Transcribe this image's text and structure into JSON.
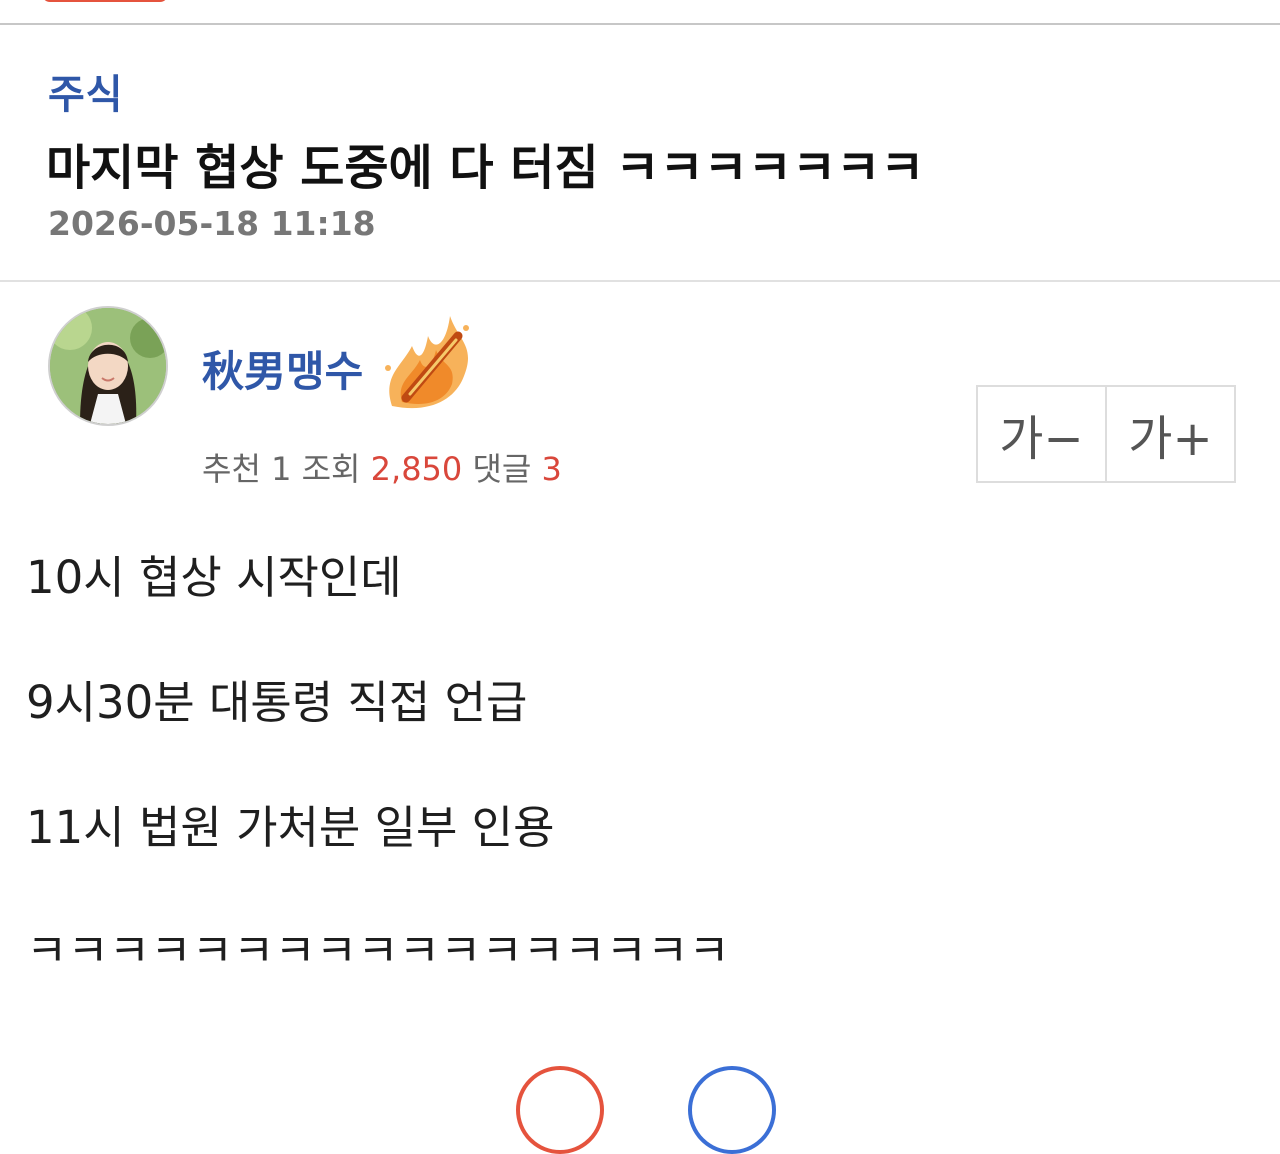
{
  "post": {
    "category": "주식",
    "title": "마지막 협상 도중에 다 터짐 ㅋㅋㅋㅋㅋㅋㅋ",
    "datetime": "2026-05-18 11:18"
  },
  "author": {
    "name": "秋男맹수",
    "avatar_icon": "avatar-photo",
    "badge_icon": "flame-badge-icon"
  },
  "stats": {
    "recommend_label": "추천",
    "recommend_value": "1",
    "views_label": "조회",
    "views_value": "2,850",
    "comments_label": "댓글",
    "comments_value": "3"
  },
  "font_controls": {
    "decrease_label": "가−",
    "increase_label": "가+"
  },
  "content": {
    "lines": [
      "10시 협상 시작인데",
      "9시30분 대통령 직접 언급",
      "11시 법원 가처분 일부 인용",
      "ㅋㅋㅋㅋㅋㅋㅋㅋㅋㅋㅋㅋㅋㅋㅋㅋㅋ"
    ]
  },
  "colors": {
    "accent_blue": "#2f57a8",
    "accent_red": "#d9473b"
  }
}
